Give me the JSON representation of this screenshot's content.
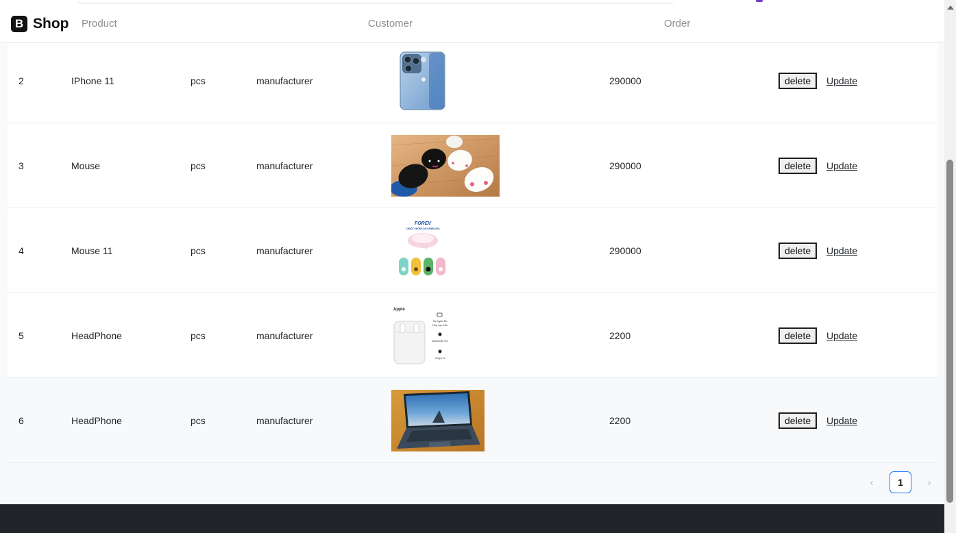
{
  "brand": {
    "logo_letter": "B",
    "name": "Shop"
  },
  "nav": {
    "product": "Product",
    "customer": "Customer",
    "order": "Order"
  },
  "rows": [
    {
      "id": "2",
      "name": "IPhone 11",
      "unit": "pcs",
      "manufacturer": "manufacturer",
      "price": "290000",
      "image": "iphone-image",
      "delete": "delete",
      "update": "Update"
    },
    {
      "id": "3",
      "name": "Mouse",
      "unit": "pcs",
      "manufacturer": "manufacturer",
      "price": "290000",
      "image": "mouse-image",
      "delete": "delete",
      "update": "Update"
    },
    {
      "id": "4",
      "name": "Mouse 11",
      "unit": "pcs",
      "manufacturer": "manufacturer",
      "price": "290000",
      "image": "mouse-product-image",
      "delete": "delete",
      "update": "Update"
    },
    {
      "id": "5",
      "name": "HeadPhone",
      "unit": "pcs",
      "manufacturer": "manufacturer",
      "price": "2200",
      "image": "airpods-image",
      "delete": "delete",
      "update": "Update"
    },
    {
      "id": "6",
      "name": "HeadPhone",
      "unit": "pcs",
      "manufacturer": "manufacturer",
      "price": "2200",
      "image": "laptop-image",
      "delete": "delete",
      "update": "Update"
    }
  ],
  "image_text": {
    "fore_logo": "FOREV",
    "fore_tagline": "CHUỘT KHÔNG DÂY WIRELESS",
    "apple_label": "Apple",
    "airpods_feature_1": "Tai nghe 5h",
    "airpods_feature_1b": "Hộp sạc 24h",
    "airpods_feature_2": "Bluetooth 5.0",
    "airpods_feature_3": "Chip H1"
  },
  "pagination": {
    "prev": "‹",
    "current": "1",
    "next": "›"
  },
  "colors": {
    "accent": "#1677ff",
    "footer": "#212529"
  }
}
